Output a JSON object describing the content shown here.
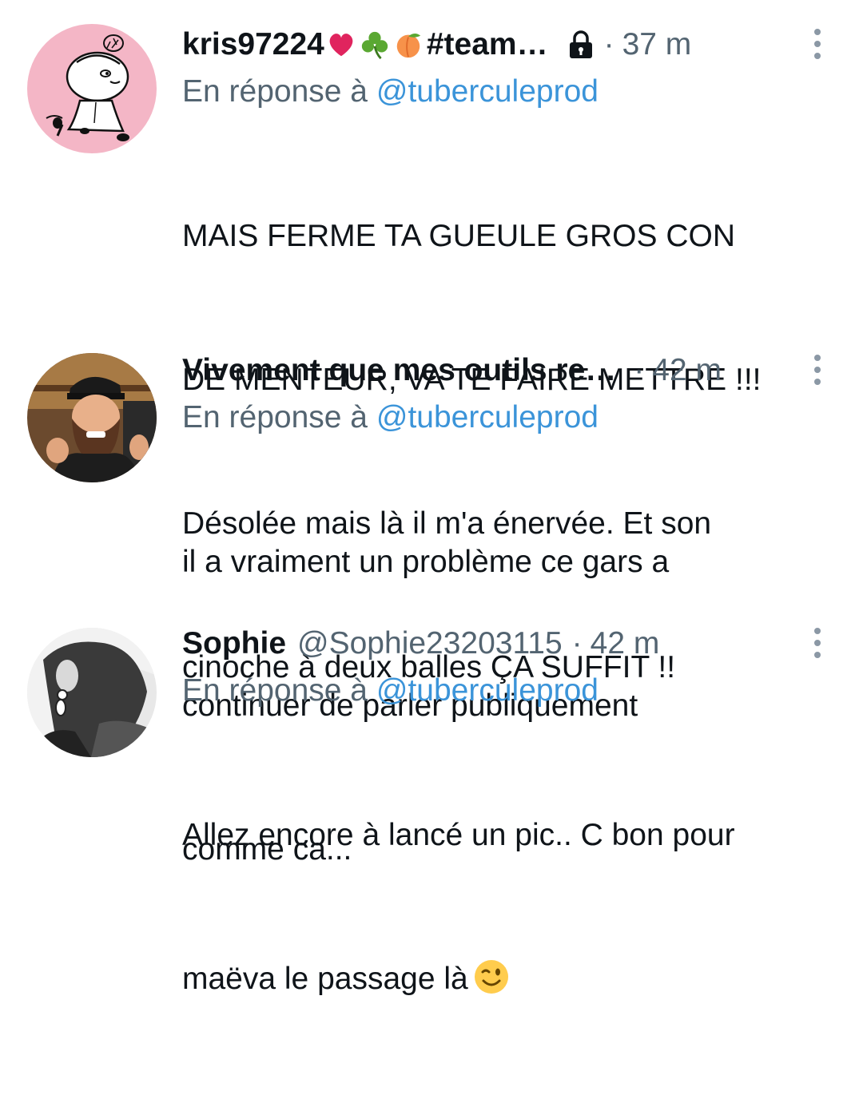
{
  "tweets": [
    {
      "display_name": "kris97224",
      "display_name_suffix": "#team…",
      "emojis": [
        "heart-emoji",
        "shamrock-emoji",
        "peach-emoji"
      ],
      "handle": "",
      "separator": "·",
      "time": "37 m",
      "reply_prefix": "En réponse à",
      "reply_mention": "@tuberculeprod",
      "text_lines": [
        "MAIS FERME TA GUEULE GROS CON",
        "DE MENTEUR, VA TE FAIRE METTRE !!!",
        "Désolée mais là il m'a énervée. Et son",
        "cinoche à deux balles ÇA SUFFIT !!"
      ],
      "protected": true,
      "avatar": "cartoon-girl-avatar"
    },
    {
      "display_name": "Vivement que mes outils re…",
      "handle": "",
      "separator": "·",
      "time": "42 m",
      "reply_prefix": "En réponse à",
      "reply_mention": "@tuberculeprod",
      "text_lines": [
        "il a vraiment un problème ce gars a",
        "continuer de parler publiquement",
        "comme ca..."
      ],
      "avatar": "bearded-man-avatar"
    },
    {
      "display_name": "Sophie",
      "handle": "@Sophie23203115",
      "separator": "·",
      "time": "42 m",
      "reply_prefix": "En réponse à",
      "reply_mention": "@tuberculeprod",
      "text_lines": [
        "Allez encore à lancé un pic.. C bon pour",
        "maëva le passage là"
      ],
      "trailing_emoji": "winking-face-emoji",
      "avatar": "woman-profile-avatar"
    }
  ],
  "colors": {
    "text": "#0f1419",
    "secondary": "#536471",
    "mention": "#3b94d9",
    "background": "#ffffff"
  }
}
